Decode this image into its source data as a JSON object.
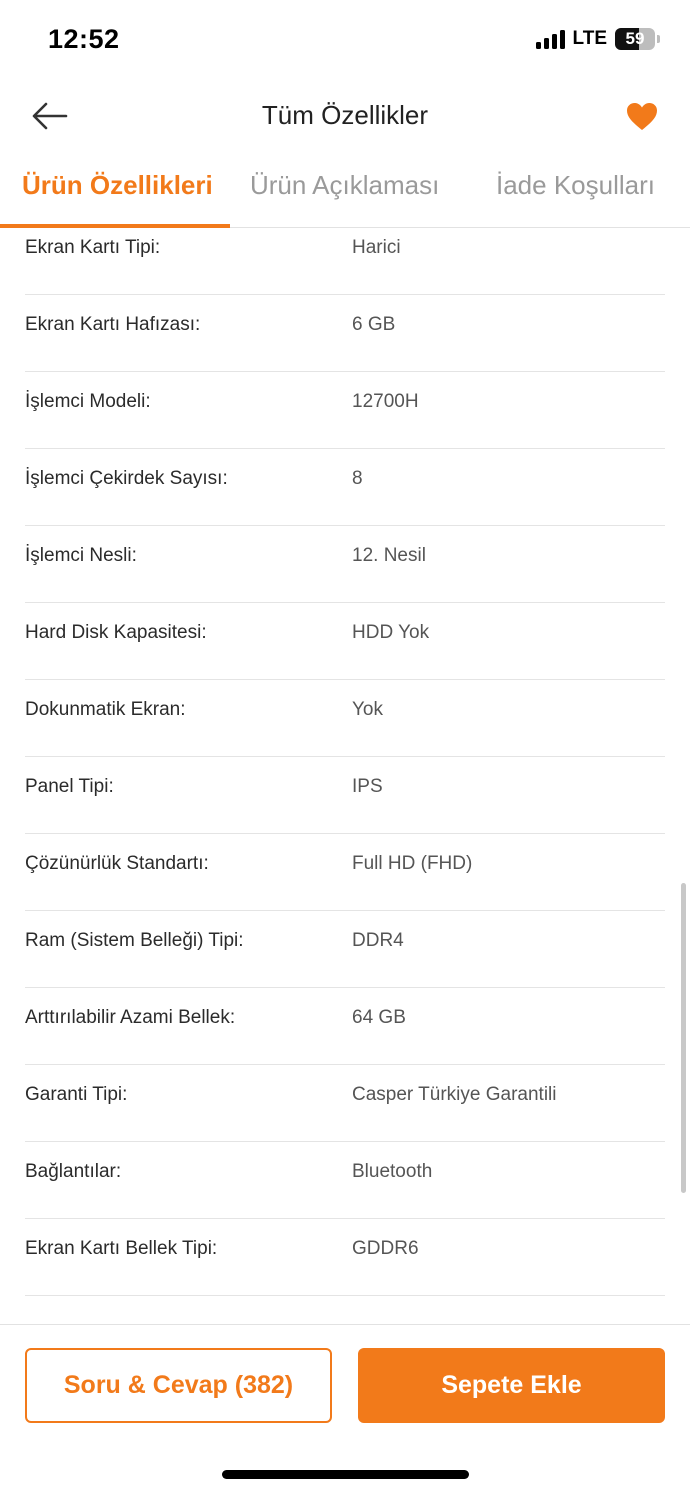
{
  "status_bar": {
    "time": "12:52",
    "network": "LTE",
    "battery_level": "59",
    "battery_fraction": 0.59
  },
  "header": {
    "title": "Tüm Özellikler",
    "back_icon": "arrow-left-icon",
    "favorite_icon": "heart-icon"
  },
  "tabs": [
    {
      "label": "Ürün Özellikleri",
      "active": true
    },
    {
      "label": "Ürün Açıklaması",
      "active": false
    },
    {
      "label": "İade Koşulları",
      "active": false
    }
  ],
  "specs": [
    {
      "label": "Ekran Kartı Tipi:",
      "value": "Harici"
    },
    {
      "label": "Ekran Kartı Hafızası:",
      "value": "6 GB"
    },
    {
      "label": "İşlemci Modeli:",
      "value": "12700H"
    },
    {
      "label": "İşlemci Çekirdek Sayısı:",
      "value": "8"
    },
    {
      "label": "İşlemci Nesli:",
      "value": "12. Nesil"
    },
    {
      "label": "Hard Disk Kapasitesi:",
      "value": "HDD Yok"
    },
    {
      "label": "Dokunmatik Ekran:",
      "value": "Yok"
    },
    {
      "label": "Panel Tipi:",
      "value": "IPS"
    },
    {
      "label": "Çözünürlük Standartı:",
      "value": "Full HD (FHD)"
    },
    {
      "label": "Ram (Sistem Belleği) Tipi:",
      "value": "DDR4"
    },
    {
      "label": "Arttırılabilir Azami Bellek:",
      "value": "64 GB"
    },
    {
      "label": "Garanti Tipi:",
      "value": "Casper Türkiye Garantili"
    },
    {
      "label": "Bağlantılar:",
      "value": "Bluetooth"
    },
    {
      "label": "Ekran Kartı Bellek Tipi:",
      "value": "GDDR6"
    }
  ],
  "actions": {
    "qa_label": "Soru & Cevap (382)",
    "cart_label": "Sepete Ekle"
  },
  "colors": {
    "accent": "#f27a1a",
    "text": "#2b2b2b",
    "muted": "#9a9a9a",
    "divider": "#e4e4e4"
  }
}
